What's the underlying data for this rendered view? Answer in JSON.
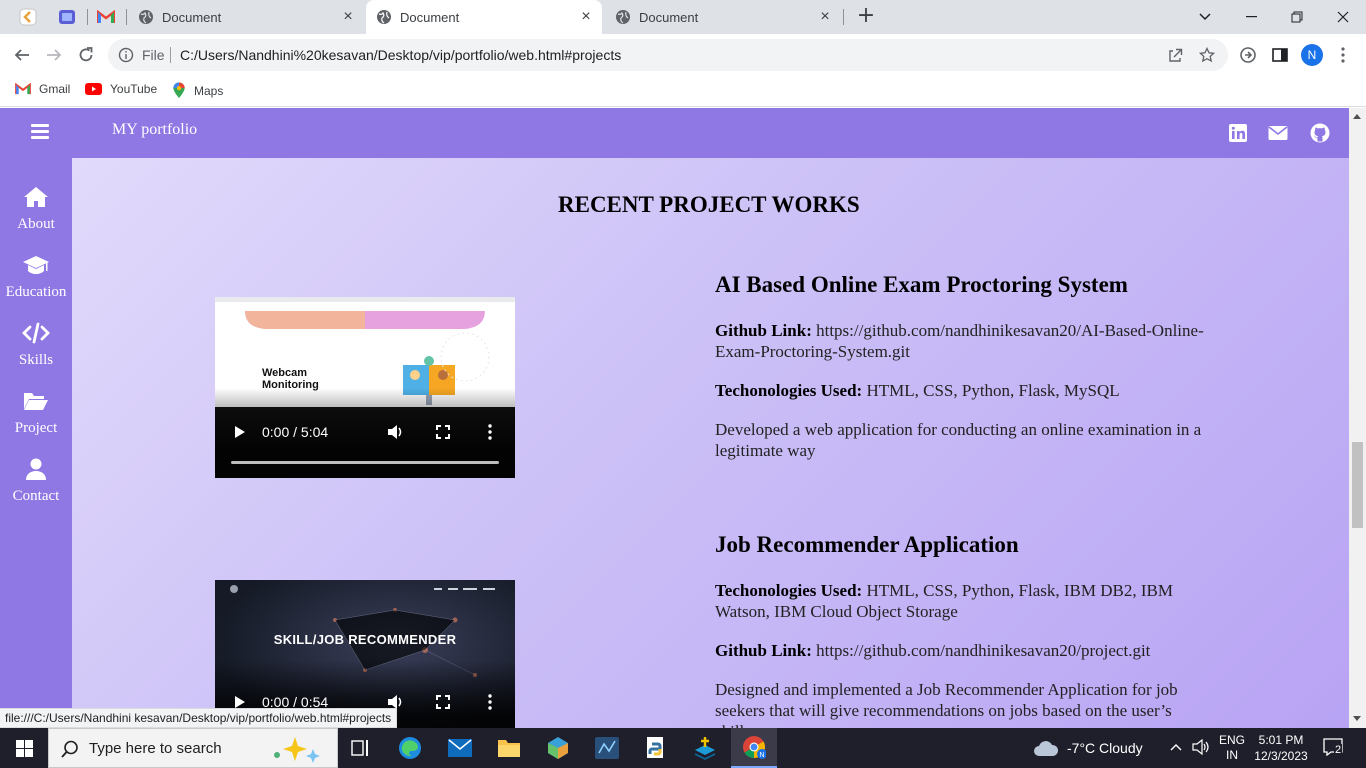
{
  "browser": {
    "tabs": [
      {
        "title": "Document",
        "active": false
      },
      {
        "title": "Document",
        "active": true
      },
      {
        "title": "Document",
        "active": false
      }
    ],
    "address": {
      "scheme_label": "File",
      "url": "C:/Users/Nandhini%20kesavan/Desktop/vip/portfolio/web.html#projects"
    },
    "profile_initial": "N",
    "bookmarks": [
      {
        "label": "Gmail",
        "icon": "gmail-icon"
      },
      {
        "label": "YouTube",
        "icon": "youtube-icon"
      },
      {
        "label": "Maps",
        "icon": "maps-icon"
      }
    ],
    "status_url": "file:///C:/Users/Nandhini kesavan/Desktop/vip/portfolio/web.html#projects"
  },
  "page": {
    "brand": "MY portfolio",
    "social": [
      "linkedin-icon",
      "mail-icon",
      "github-icon"
    ],
    "sidebar": [
      {
        "label": "About",
        "icon": "home-icon"
      },
      {
        "label": "Education",
        "icon": "graduation-cap-icon"
      },
      {
        "label": "Skills",
        "icon": "code-icon"
      },
      {
        "label": "Project",
        "icon": "folder-open-icon"
      },
      {
        "label": "Contact",
        "icon": "user-icon"
      }
    ],
    "section_title": "RECENT PROJECT WORKS",
    "projects": [
      {
        "title": "AI Based Online Exam Proctoring System",
        "github_label": "Github Link:",
        "github_url": "https://github.com/nandhinikesavan20/AI-Based-Online-Exam-Proctoring-System.git",
        "tech_label": "Techonologies Used:",
        "tech": "HTML, CSS, Python, Flask, MySQL",
        "description": "Developed a web application for conducting an online examination in a legitimate way",
        "video": {
          "time": "0:00 / 5:04",
          "poster_heading": "Webcam Monitoring"
        }
      },
      {
        "title": "Job Recommender Application",
        "tech_label": "Techonologies Used:",
        "tech": "HTML, CSS, Python, Flask, IBM DB2, IBM Watson, IBM Cloud Object Storage",
        "github_label": "Github Link:",
        "github_url": "https://github.com/nandhinikesavan20/project.git",
        "description": "Designed and implemented a Job Recommender Application for job seekers that will give recommendations on jobs based on the user’s skills",
        "video": {
          "time": "0:00 / 0:54",
          "poster_heading": "SKILL/JOB RECOMMENDER"
        }
      }
    ]
  },
  "taskbar": {
    "search_placeholder": "Type here to search",
    "weather": "-7°C  Cloudy",
    "lang_top": "ENG",
    "lang_bottom": "IN",
    "time": "5:01 PM",
    "date": "12/3/2023",
    "notifications": "2"
  },
  "colors": {
    "nav_purple": "#8f77e4",
    "page_gradient_start": "#e5defc",
    "page_gradient_end": "#b8a3f4"
  }
}
